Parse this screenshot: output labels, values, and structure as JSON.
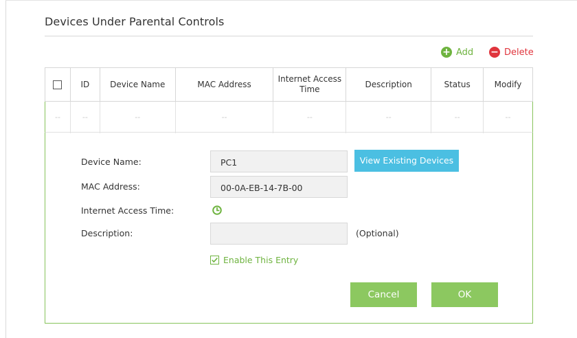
{
  "section": {
    "title": "Devices Under Parental Controls"
  },
  "toolbar": {
    "add_label": "Add",
    "delete_label": "Delete"
  },
  "table": {
    "headers": {
      "id": "ID",
      "device_name": "Device Name",
      "mac_address": "MAC Address",
      "internet_access_time": "Internet Access Time",
      "description": "Description",
      "status": "Status",
      "modify": "Modify"
    },
    "row": {
      "select": "--",
      "id": "--",
      "device_name": "--",
      "mac_address": "--",
      "internet_access_time": "--",
      "description": "--",
      "status": "--",
      "modify": "--"
    }
  },
  "form": {
    "device_name_label": "Device Name:",
    "device_name_value": "PC1",
    "view_existing_label": "View Existing Devices",
    "mac_address_label": "MAC Address:",
    "mac_address_value": "00-0A-EB-14-7B-00",
    "internet_access_time_label": "Internet Access Time:",
    "description_label": "Description:",
    "description_value": "",
    "optional_text": "(Optional)",
    "enable_label": "Enable This Entry",
    "enable_checked": true,
    "cancel_label": "Cancel",
    "ok_label": "OK"
  },
  "colors": {
    "accent_green": "#6eb33f",
    "button_green": "#8cc860",
    "delete_red": "#e0353d",
    "info_blue": "#4bbfe2"
  },
  "icons": {
    "add": "plus-circle-icon",
    "delete": "minus-circle-icon",
    "time": "clock-icon",
    "enable": "checkbox-checked-icon"
  }
}
